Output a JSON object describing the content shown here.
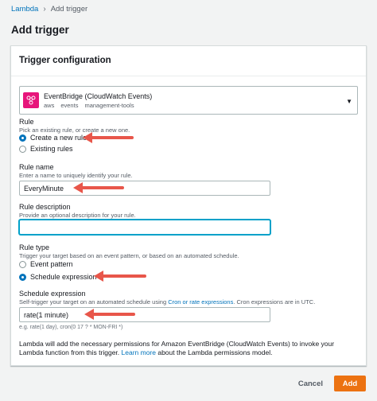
{
  "breadcrumb": {
    "root": "Lambda",
    "current": "Add trigger"
  },
  "page_title": "Add trigger",
  "panel": {
    "header": "Trigger configuration",
    "trigger": {
      "name": "EventBridge (CloudWatch Events)",
      "tags": [
        "aws",
        "events",
        "management-tools"
      ],
      "icon": "eventbridge-icon",
      "icon_color": "#e7157b"
    },
    "rule": {
      "label": "Rule",
      "description": "Pick an existing rule, or create a new one.",
      "options": [
        "Create a new rule",
        "Existing rules"
      ],
      "selected": "Create a new rule"
    },
    "rule_name": {
      "label": "Rule name",
      "description": "Enter a name to uniquely identify your rule.",
      "value": "EveryMinute"
    },
    "rule_description": {
      "label": "Rule description",
      "description": "Provide an optional description for your rule.",
      "value": ""
    },
    "rule_type": {
      "label": "Rule type",
      "description": "Trigger your target based on an event pattern, or based on an automated schedule.",
      "options": [
        "Event pattern",
        "Schedule expression"
      ],
      "selected": "Schedule expression"
    },
    "schedule_expression": {
      "label": "Schedule expression",
      "description_pre": "Self-trigger your target on an automated schedule using ",
      "description_link": "Cron or rate expressions",
      "description_post": ". Cron expressions are in UTC.",
      "value": "rate(1 minute)",
      "hint": "e.g. rate(1 day), cron(0 17 ? * MON-FRI *)"
    },
    "permissions": {
      "text_pre": "Lambda will add the necessary permissions for Amazon EventBridge (CloudWatch Events) to invoke your Lambda function from this trigger. ",
      "link": "Learn more",
      "text_post": " about the Lambda permissions model."
    }
  },
  "footer": {
    "cancel_label": "Cancel",
    "add_label": "Add"
  },
  "colors": {
    "accent": "#0073bb",
    "primary_button": "#ec7211",
    "annotation_arrow": "#e8564a"
  }
}
